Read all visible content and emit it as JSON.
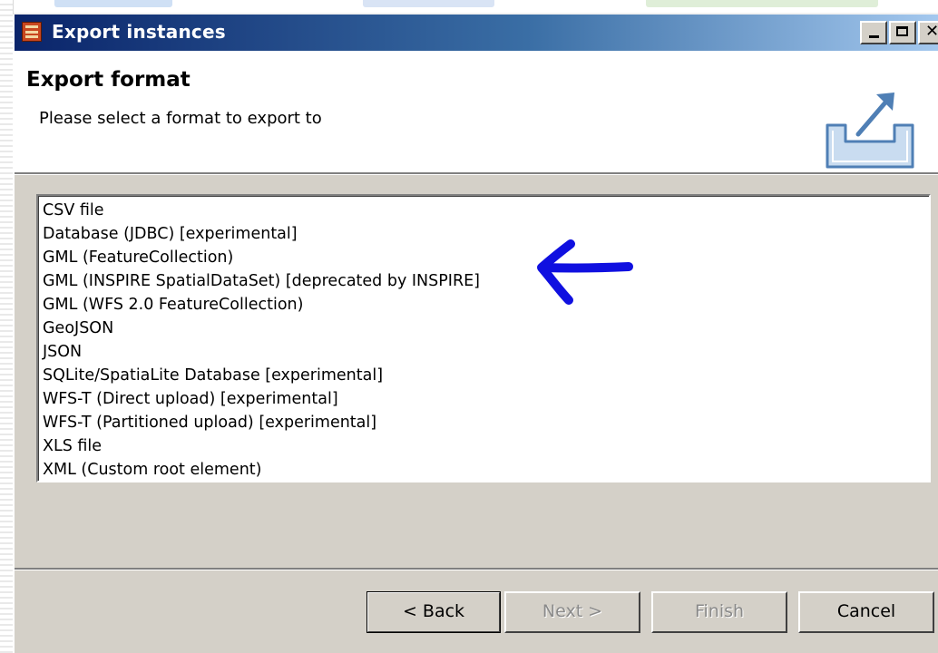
{
  "window": {
    "title": "Export instances"
  },
  "header": {
    "title": "Export format",
    "description": "Please select a format to export to"
  },
  "formats": [
    "CSV file",
    "Database (JDBC) [experimental]",
    "GML (FeatureCollection)",
    "GML (INSPIRE SpatialDataSet) [deprecated by INSPIRE]",
    "GML (WFS 2.0 FeatureCollection)",
    "GeoJSON",
    "JSON",
    "SQLite/SpatiaLite Database [experimental]",
    "WFS-T (Direct upload) [experimental]",
    "WFS-T (Partitioned upload) [experimental]",
    "XLS file",
    "XML (Custom root element)"
  ],
  "buttons": {
    "back": "< Back",
    "next": "Next >",
    "finish": "Finish",
    "cancel": "Cancel"
  },
  "icons": {
    "window": "app-icon",
    "header": "export-icon",
    "annotation": "blue-arrow-annotation"
  },
  "colors": {
    "titlebar_start": "#0a246a",
    "titlebar_end": "#a6caf0",
    "annotation": "#1010e0",
    "dialog_face": "#d4d0c8"
  }
}
